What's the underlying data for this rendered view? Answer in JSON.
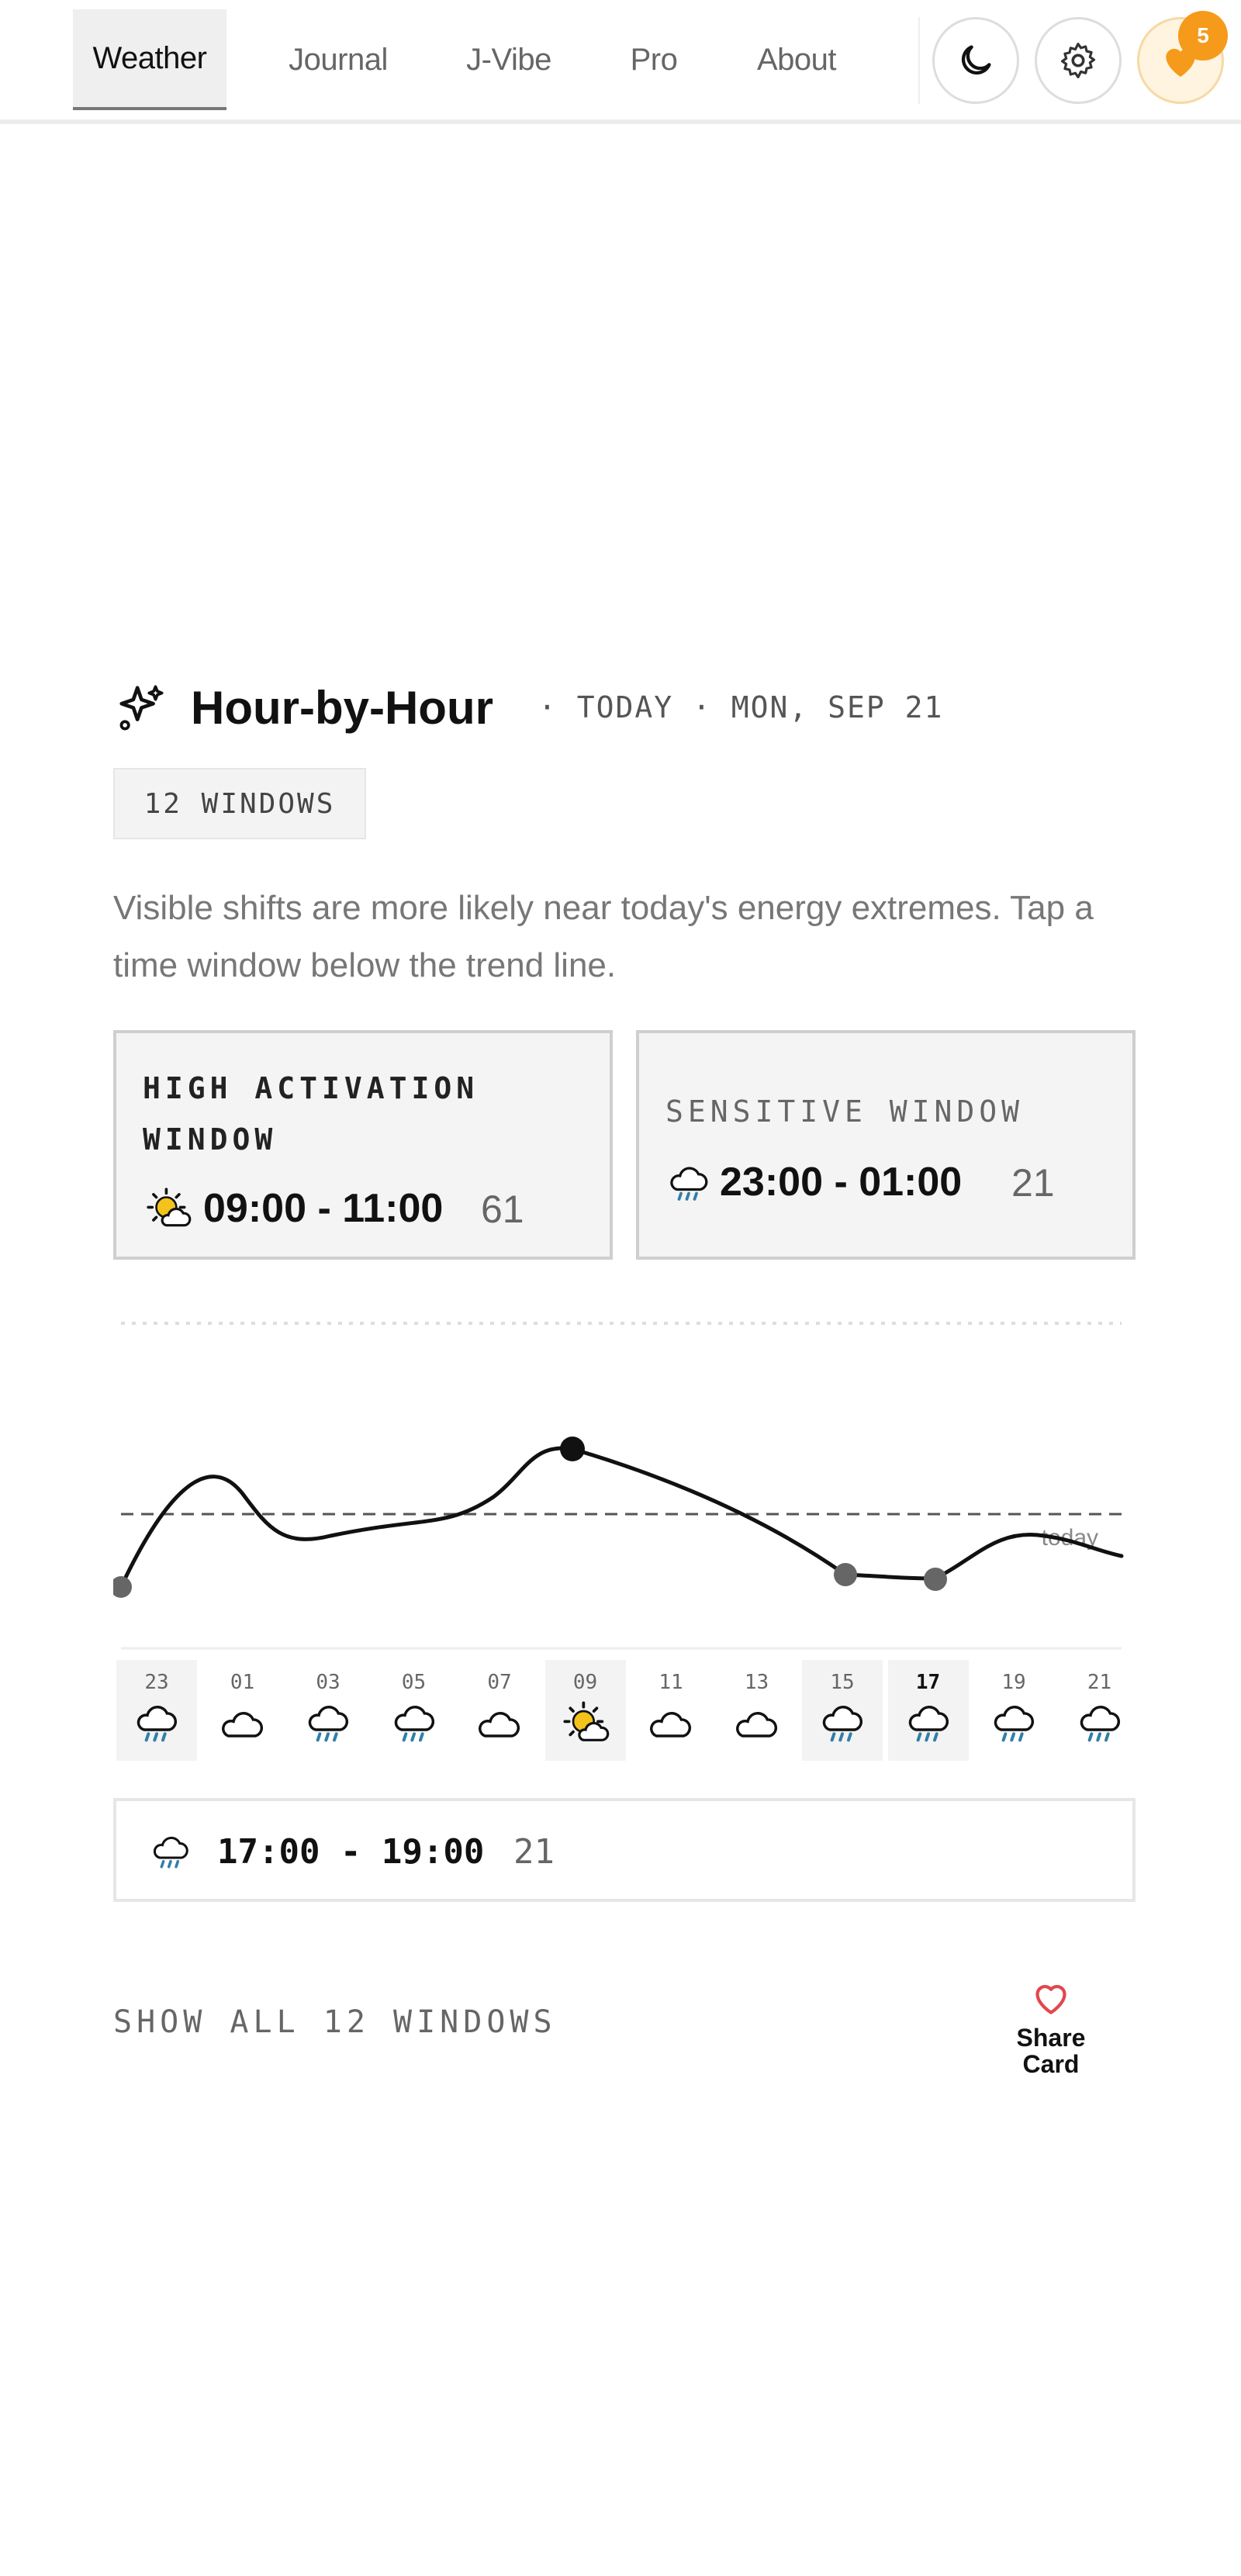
{
  "nav": {
    "tabs": [
      {
        "label": "Weather",
        "active": true
      },
      {
        "label": "Journal",
        "active": false
      },
      {
        "label": "J-Vibe",
        "active": false
      },
      {
        "label": "Pro",
        "active": false
      },
      {
        "label": "About",
        "active": false
      }
    ],
    "buttons": {
      "theme_icon": "moon-icon",
      "settings_icon": "gear-icon",
      "favorites_icon": "heart-icon",
      "favorites_count": "5"
    }
  },
  "header": {
    "icon": "sparkle-icon",
    "title": "Hour-by-Hour",
    "subtitle": "· TODAY · MON, SEP 21",
    "windows_badge": "12 WINDOWS",
    "description": "Visible shifts are more likely near today's energy extremes. Tap a time window below the trend line."
  },
  "cards": {
    "high": {
      "title": "HIGH ACTIVATION WINDOW",
      "icon": "sun-cloud-icon",
      "time": "09:00 - 11:00",
      "score": "61"
    },
    "sensitive": {
      "title": "SENSITIVE WINDOW",
      "icon": "rain-cloud-icon",
      "time": "23:00 - 01:00",
      "score": "21"
    }
  },
  "chart_data": {
    "type": "line",
    "x": [
      "23",
      "01",
      "03",
      "05",
      "07",
      "09",
      "11",
      "13",
      "15",
      "17",
      "19",
      "21"
    ],
    "baseline_label": "today",
    "marked_points": [
      0,
      5,
      8,
      9
    ]
  },
  "hours": [
    {
      "label": "23",
      "icon": "rain-cloud-icon",
      "highlight": true,
      "bold": false
    },
    {
      "label": "01",
      "icon": "cloud-icon",
      "highlight": false,
      "bold": false
    },
    {
      "label": "03",
      "icon": "rain-cloud-icon",
      "highlight": false,
      "bold": false
    },
    {
      "label": "05",
      "icon": "rain-cloud-icon",
      "highlight": false,
      "bold": false
    },
    {
      "label": "07",
      "icon": "cloud-icon",
      "highlight": false,
      "bold": false
    },
    {
      "label": "09",
      "icon": "sun-cloud-icon",
      "highlight": true,
      "bold": false
    },
    {
      "label": "11",
      "icon": "cloud-icon",
      "highlight": false,
      "bold": false
    },
    {
      "label": "13",
      "icon": "cloud-icon",
      "highlight": false,
      "bold": false
    },
    {
      "label": "15",
      "icon": "rain-cloud-icon",
      "highlight": true,
      "bold": false
    },
    {
      "label": "17",
      "icon": "rain-cloud-icon",
      "highlight": true,
      "bold": true
    },
    {
      "label": "19",
      "icon": "rain-cloud-icon",
      "highlight": false,
      "bold": false
    },
    {
      "label": "21",
      "icon": "rain-cloud-icon",
      "highlight": false,
      "bold": false
    }
  ],
  "selected_window": {
    "icon": "rain-cloud-icon",
    "time": "17:00 - 19:00",
    "score": "21"
  },
  "footer": {
    "show_all": "SHOW ALL 12 WINDOWS",
    "share_label": "Share Card",
    "share_icon": "heart-outline-icon"
  },
  "colors": {
    "accent": "#f59a1b",
    "share_heart": "#e0484f",
    "rain": "#2f7fa8",
    "sun": "#f3c21b"
  }
}
